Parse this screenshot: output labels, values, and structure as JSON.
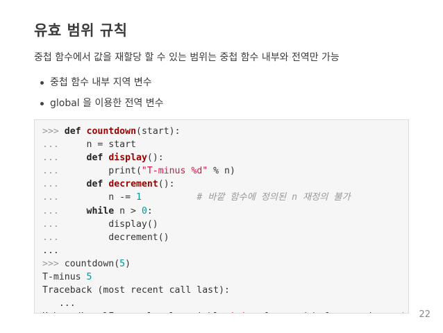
{
  "slide": {
    "title": "유효 범위 규칙",
    "subtitle": "중첩 함수에서 값을 재할당 할 수 있는 범위는 중첩 함수 내부와 전역만 가능",
    "bullets": [
      "중첩 함수 내부 지역 변수",
      "global 을 이용한 전역 변수"
    ],
    "page_number": "22"
  },
  "code": {
    "lines": [
      [
        {
          "c": "p",
          "t": ">>> "
        },
        {
          "c": "kw",
          "t": "def"
        },
        {
          "c": "",
          "t": " "
        },
        {
          "c": "fn",
          "t": "countdown"
        },
        {
          "c": "",
          "t": "(start):"
        }
      ],
      [
        {
          "c": "p",
          "t": "... "
        },
        {
          "c": "",
          "t": "    n = start"
        }
      ],
      [
        {
          "c": "p",
          "t": "... "
        },
        {
          "c": "",
          "t": "    "
        },
        {
          "c": "kw",
          "t": "def"
        },
        {
          "c": "",
          "t": " "
        },
        {
          "c": "fn",
          "t": "display"
        },
        {
          "c": "",
          "t": "():"
        }
      ],
      [
        {
          "c": "p",
          "t": "... "
        },
        {
          "c": "",
          "t": "        print("
        },
        {
          "c": "st",
          "t": "\"T-minus %d\""
        },
        {
          "c": "",
          "t": " % n)"
        }
      ],
      [
        {
          "c": "p",
          "t": "... "
        },
        {
          "c": "",
          "t": "    "
        },
        {
          "c": "kw",
          "t": "def"
        },
        {
          "c": "",
          "t": " "
        },
        {
          "c": "fn",
          "t": "decrement"
        },
        {
          "c": "",
          "t": "():"
        }
      ],
      [
        {
          "c": "p",
          "t": "... "
        },
        {
          "c": "",
          "t": "        n -= "
        },
        {
          "c": "nm",
          "t": "1"
        },
        {
          "c": "",
          "t": "          "
        },
        {
          "c": "cm",
          "t": "# 바깥 함수에 정의된 n 재정의 불가"
        }
      ],
      [
        {
          "c": "p",
          "t": "... "
        },
        {
          "c": "",
          "t": "    "
        },
        {
          "c": "kw",
          "t": "while"
        },
        {
          "c": "",
          "t": " n > "
        },
        {
          "c": "nm",
          "t": "0"
        },
        {
          "c": "",
          "t": ":"
        }
      ],
      [
        {
          "c": "p",
          "t": "... "
        },
        {
          "c": "",
          "t": "        display()"
        }
      ],
      [
        {
          "c": "p",
          "t": "... "
        },
        {
          "c": "",
          "t": "        decrement()"
        }
      ],
      [
        {
          "c": "",
          "t": "..."
        }
      ],
      [
        {
          "c": "p",
          "t": ">>> "
        },
        {
          "c": "",
          "t": "countdown("
        },
        {
          "c": "nm",
          "t": "5"
        },
        {
          "c": "",
          "t": ")"
        }
      ],
      [
        {
          "c": "",
          "t": "T-minus "
        },
        {
          "c": "nm",
          "t": "5"
        }
      ],
      [
        {
          "c": "",
          "t": "Traceback (most recent call last):"
        }
      ],
      [
        {
          "c": "",
          "t": "   ..."
        }
      ],
      [
        {
          "c": "",
          "t": "UnboundLocalError: local variable "
        },
        {
          "c": "st",
          "t": "'n'"
        },
        {
          "c": "",
          "t": " referenced before assignment"
        }
      ]
    ]
  }
}
